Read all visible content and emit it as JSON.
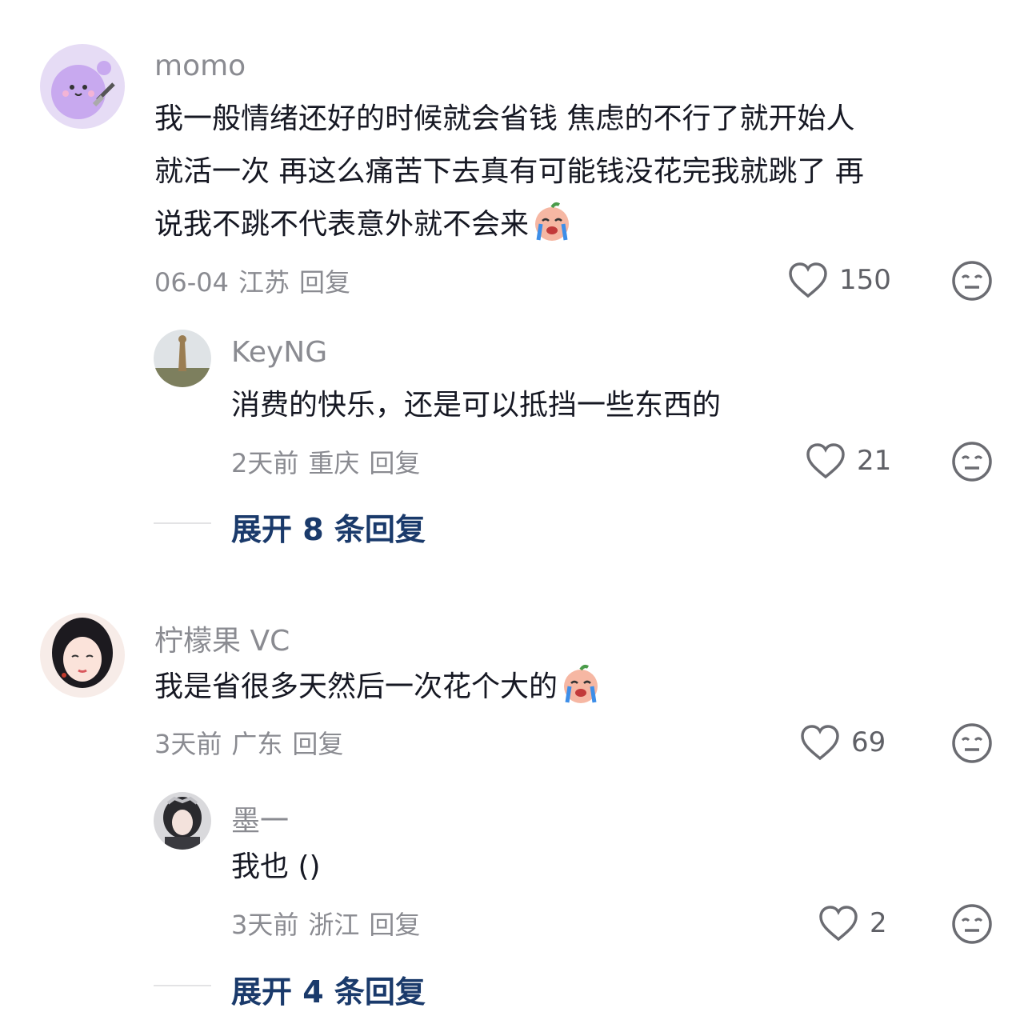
{
  "comments": [
    {
      "author": "momo",
      "text": "我一般情绪还好的时候就会省钱 焦虑的不行了就开始人就活一次 再这么痛苦下去真有可能钱没花完我就跳了 再说我不跳不代表意外就不会来",
      "lines": [
        "我一般情绪还好的时候就会省钱 焦虑的不行了就开始人",
        "就活一次 再这么痛苦下去真有可能钱没花完我就跳了 再",
        "说我不跳不代表意外就不会来"
      ],
      "emoji": "crying-peach-emoji",
      "date": "06-04",
      "location": "江苏",
      "reply_label": "回复",
      "likes": "150",
      "reply": {
        "author": "KeyNG",
        "text": "消费的快乐，还是可以抵挡一些东西的",
        "date": "2天前",
        "location": "重庆",
        "reply_label": "回复",
        "likes": "21"
      },
      "expand_label": "展开 8 条回复"
    },
    {
      "author": "柠檬果 VC",
      "text": "我是省很多天然后一次花个大的",
      "emoji": "crying-peach-emoji",
      "date": "3天前",
      "location": "广东",
      "reply_label": "回复",
      "likes": "69",
      "reply": {
        "author": "墨一",
        "text": "我也 ()",
        "date": "3天前",
        "location": "浙江",
        "reply_label": "回复",
        "likes": "2"
      },
      "expand_label": "展开 4 条回复"
    }
  ],
  "icons": {
    "like": "heart-outline-icon",
    "dislike": "neutral-face-icon"
  },
  "colors": {
    "text": "#161823",
    "secondary": "#8a8b91",
    "expand": "#1a3a6b"
  }
}
